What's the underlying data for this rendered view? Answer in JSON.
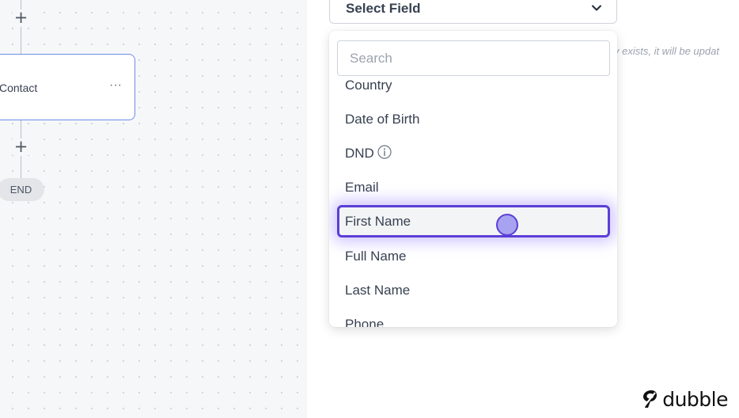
{
  "canvas": {
    "node_label": "Contact",
    "node_menu": "···",
    "plus_symbol": "+",
    "end_label": "END"
  },
  "panel": {
    "select_field_label": "Select Field",
    "hint_text": "y exists, it will be updat",
    "search_placeholder": "Search",
    "options": [
      {
        "label": "Country"
      },
      {
        "label": "Date of Birth"
      },
      {
        "label": "DND",
        "icon": "info-icon"
      },
      {
        "label": "Email"
      },
      {
        "label": "First Name",
        "highlighted": true
      },
      {
        "label": "Full Name"
      },
      {
        "label": "Last Name"
      },
      {
        "label": "Phone"
      }
    ]
  },
  "brand": {
    "name": "dubble",
    "icon": "dubble-logo-icon"
  },
  "colors": {
    "canvas_bg": "#f6f7f9",
    "node_border": "#6d8ce8",
    "highlight_border": "#5b3fd6",
    "cursor_fill": "#a7a3f0"
  }
}
